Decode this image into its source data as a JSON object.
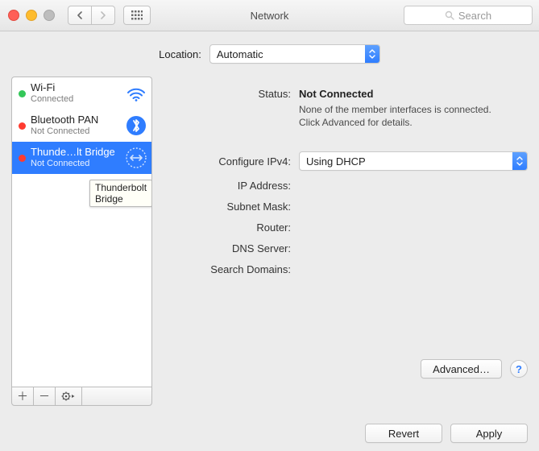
{
  "window": {
    "title": "Network"
  },
  "toolbar": {
    "search_placeholder": "Search"
  },
  "location": {
    "label": "Location:",
    "selected": "Automatic"
  },
  "sidebar": {
    "items": [
      {
        "name": "Wi-Fi",
        "status": "Connected",
        "dot": "green",
        "icon": "wifi"
      },
      {
        "name": "Bluetooth PAN",
        "status": "Not Connected",
        "dot": "red",
        "icon": "bluetooth"
      },
      {
        "name": "Thunde…lt Bridge",
        "status": "Not Connected",
        "dot": "red",
        "icon": "thunderbolt"
      }
    ],
    "selected_index": 2,
    "tooltip": "Thunderbolt Bridge"
  },
  "form": {
    "status_label": "Status:",
    "status_value": "Not Connected",
    "status_sub1": "None of the member interfaces is connected.",
    "status_sub2": "Click Advanced for details.",
    "configure_label": "Configure IPv4:",
    "configure_value": "Using DHCP",
    "ip_label": "IP Address:",
    "subnet_label": "Subnet Mask:",
    "router_label": "Router:",
    "dns_label": "DNS Server:",
    "search_label": "Search Domains:"
  },
  "buttons": {
    "advanced": "Advanced…",
    "help": "?",
    "revert": "Revert",
    "apply": "Apply"
  }
}
